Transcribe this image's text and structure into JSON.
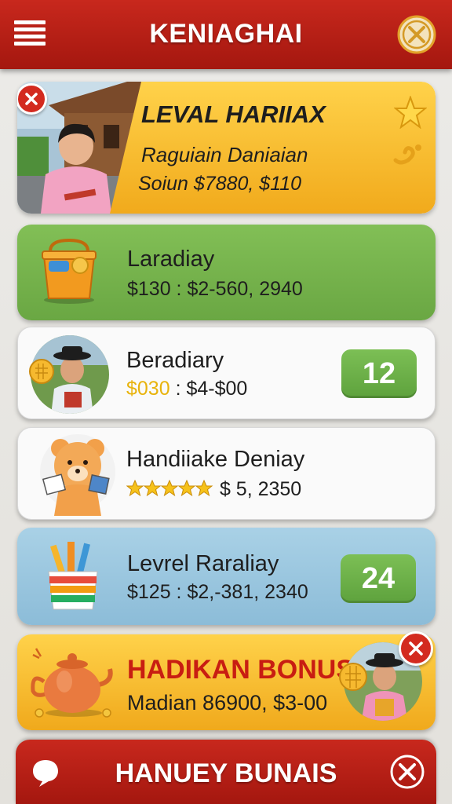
{
  "header": {
    "title": "KENIAGHAI",
    "menu_icon": "hamburger-menu-icon",
    "close_icon": "circle-x-icon"
  },
  "cards": [
    {
      "title": "LEVAL HARIIAX",
      "line1": "Raguiain Daniaian",
      "line2": "Soiun $7880, $110",
      "image": "child-photo",
      "decorations": [
        "star-icon",
        "swirl-icon"
      ]
    },
    {
      "title": "Laradiay",
      "line": "$130 : $2-560, 2940",
      "icon": "toy-basket-icon"
    },
    {
      "title": "Beradiary",
      "price_gold": "$030",
      "price_rest": ": $4-$00",
      "badge": "12",
      "image": "child-hat-photo"
    },
    {
      "title": "Handiiake Deniay",
      "rating": 5,
      "line": "$ 5, 2350",
      "icon": "teddy-bear-icon"
    },
    {
      "title": "Levrel Raraliay",
      "line": "$125 : $2,-381, 2340",
      "badge": "24",
      "icon": "pencil-cup-icon"
    },
    {
      "title": "HADIKAN BONUS",
      "line": "Madian 86900, $3-00",
      "icon": "teapot-icon",
      "image": "child-hat-photo"
    }
  ],
  "bottom": {
    "title": "HANUEY BUNAIS",
    "left_icon": "chat-bubble-icon",
    "right_icon": "circle-x-icon"
  },
  "colors": {
    "header_red": "#b81f15",
    "green": "#76b64e",
    "yellow": "#f6bd2e",
    "blue": "#9cc8df",
    "bonus_red": "#c81d12"
  }
}
